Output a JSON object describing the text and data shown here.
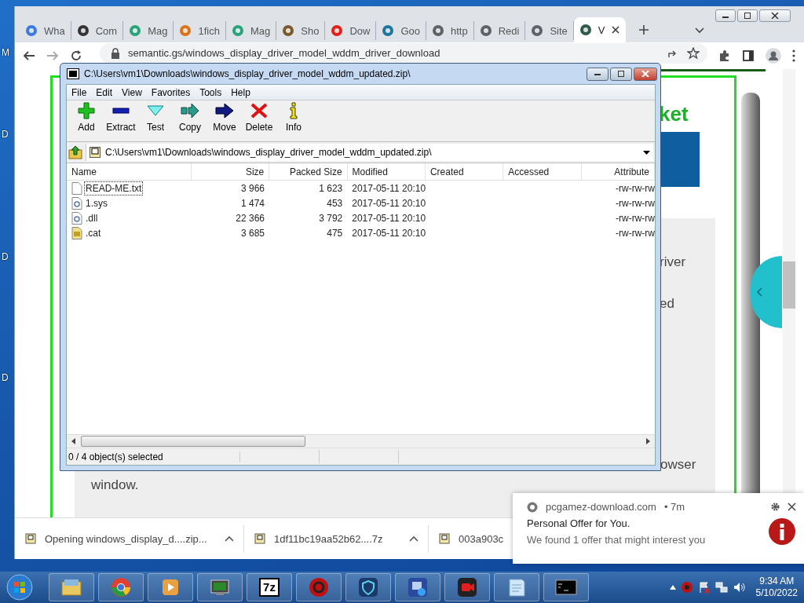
{
  "desktop": {
    "edge_labels": [
      "M",
      "D",
      "D",
      "D"
    ]
  },
  "browser": {
    "tabs": [
      {
        "title": "Wha",
        "selected": false
      },
      {
        "title": "Com",
        "selected": false
      },
      {
        "title": "Mag",
        "selected": false
      },
      {
        "title": "1fich",
        "selected": false
      },
      {
        "title": "Mag",
        "selected": false
      },
      {
        "title": "Sho",
        "selected": false
      },
      {
        "title": "Dow",
        "selected": false
      },
      {
        "title": "Goo",
        "selected": false
      },
      {
        "title": "http",
        "selected": false
      },
      {
        "title": "Redi",
        "selected": false
      },
      {
        "title": "Site",
        "selected": false
      },
      {
        "title": "V",
        "selected": true
      }
    ],
    "url": "semantic.gs/windows_display_driver_model_wddm_driver_download",
    "page": {
      "heading": "ket",
      "fragment_1": "river",
      "fragment_2": "ed",
      "fragment_3": "owser",
      "last_line": "window."
    },
    "downloads": [
      {
        "name": "Opening windows_display_d....zip..."
      },
      {
        "name": "1df11bc19aa52b62....7z"
      },
      {
        "name": "003a903c"
      }
    ]
  },
  "archiver": {
    "title": "C:\\Users\\vm1\\Downloads\\windows_display_driver_model_wddm_updated.zip\\",
    "menu": [
      "File",
      "Edit",
      "View",
      "Favorites",
      "Tools",
      "Help"
    ],
    "tools": [
      {
        "label": "Add",
        "kind": "add"
      },
      {
        "label": "Extract",
        "kind": "extract"
      },
      {
        "label": "Test",
        "kind": "test"
      },
      {
        "label": "Copy",
        "kind": "copy"
      },
      {
        "label": "Move",
        "kind": "move"
      },
      {
        "label": "Delete",
        "kind": "delete"
      },
      {
        "label": "Info",
        "kind": "info"
      }
    ],
    "path": "C:\\Users\\vm1\\Downloads\\windows_display_driver_model_wddm_updated.zip\\",
    "columns": [
      "Name",
      "Size",
      "Packed Size",
      "Modified",
      "Created",
      "Accessed",
      "Attribute"
    ],
    "rows": [
      {
        "name": "READ-ME.txt",
        "kind": "text",
        "size": "3 966",
        "packed": "1 623",
        "modified": "2017-05-11 20:10",
        "attributes": "-rw-rw-rw",
        "focused": true
      },
      {
        "name": "1.sys",
        "kind": "system",
        "size": "1 474",
        "packed": "453",
        "modified": "2017-05-11 20:10",
        "attributes": "-rw-rw-rw",
        "focused": false
      },
      {
        "name": ".dll",
        "kind": "system",
        "size": "22 366",
        "packed": "3 792",
        "modified": "2017-05-11 20:10",
        "attributes": "-rw-rw-rw",
        "focused": false
      },
      {
        "name": ".cat",
        "kind": "catalog",
        "size": "3 685",
        "packed": "475",
        "modified": "2017-05-11 20:10",
        "attributes": "-rw-rw-rw",
        "focused": false
      }
    ],
    "status": "0 / 4 object(s) selected"
  },
  "notification": {
    "site": "pcgamez-download.com",
    "age": "• 7m",
    "title": "Personal Offer for You.",
    "body": "We found 1 offer that might interest you"
  },
  "taskbar": {
    "apps": [
      {
        "kind": "folder"
      },
      {
        "kind": "chrome"
      },
      {
        "kind": "media"
      },
      {
        "kind": "monitor"
      },
      {
        "kind": "sevenzip",
        "label": "7z"
      },
      {
        "kind": "gear"
      },
      {
        "kind": "shield"
      },
      {
        "kind": "image"
      },
      {
        "kind": "recorder"
      },
      {
        "kind": "notepad"
      },
      {
        "kind": "console"
      }
    ],
    "time": "9:34 AM",
    "date": "5/10/2022"
  }
}
